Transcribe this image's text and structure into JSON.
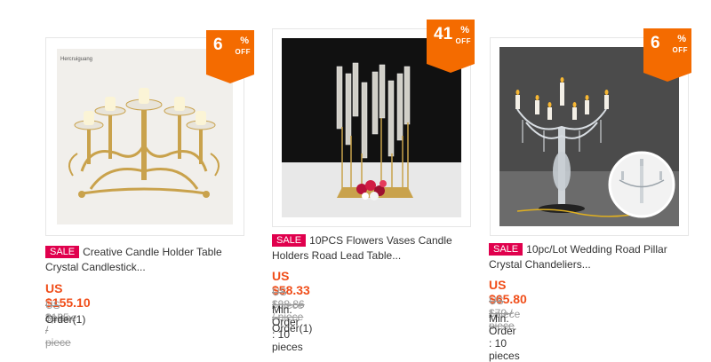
{
  "products": [
    {
      "discount": "6",
      "off": "OFF",
      "sale": "SALE",
      "title_line1": "Creative Candle Holder Table",
      "title_line2": "Crystal Candlestick...",
      "price": "US $155.10",
      "per": " / piece",
      "old_price": "US $165 / piece",
      "order": "Order(1)",
      "watermark": "Hercruiguang"
    },
    {
      "discount": "41",
      "off": "OFF",
      "sale": "SALE",
      "title_line1": "10PCS Flowers Vases Candle",
      "title_line2": "Holders Road Lead Table...",
      "price": "US $58.33",
      "per": " / piece",
      "old_price": "US $98.86 / piece",
      "min_order": "Min. Order : 10 pieces",
      "order": "Order(1)"
    },
    {
      "discount": "6",
      "off": "OFF",
      "sale": "SALE",
      "title_line1": "10pc/Lot Wedding Road Pillar",
      "title_line2": "Crystal Chandeliers...",
      "price": "US $65.80",
      "per": " / piece",
      "old_price": "US $70 / piece",
      "min_order": "Min. Order : 10 pieces"
    }
  ],
  "percent_sign": "%",
  "colors": {
    "badge": "#f46b00",
    "sale": "#e0004d",
    "price": "#f04e1a"
  }
}
